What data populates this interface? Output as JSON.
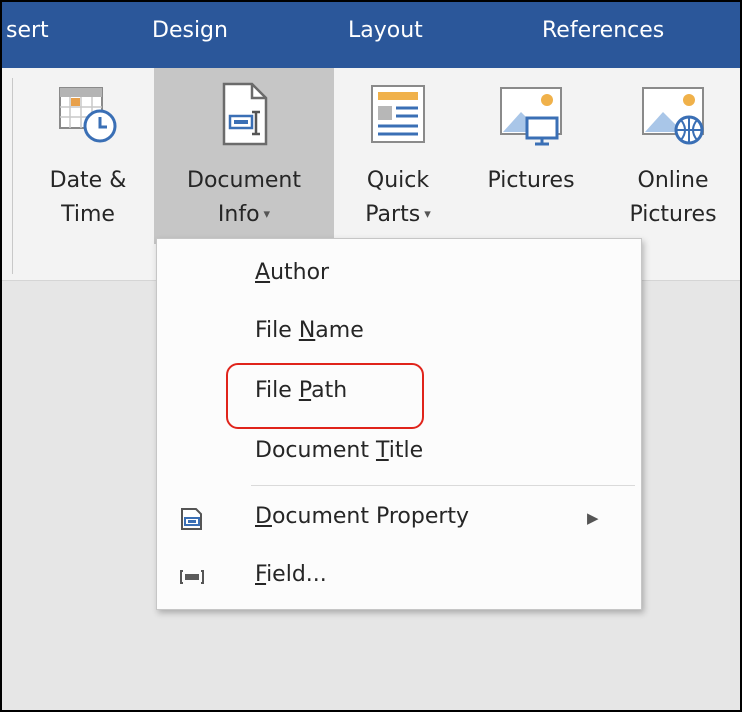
{
  "tabs": [
    {
      "label": "sert"
    },
    {
      "label": "Design"
    },
    {
      "label": "Layout"
    },
    {
      "label": "References"
    }
  ],
  "ribbon": {
    "buttons": [
      {
        "line1": "Date &",
        "line2": "Time",
        "icon": "calendar-clock-icon"
      },
      {
        "line1": "Document",
        "line2": "Info",
        "icon": "document-info-icon",
        "has_dropdown": true,
        "pressed": true
      },
      {
        "line1": "Quick",
        "line2": "Parts",
        "icon": "quick-parts-icon",
        "has_dropdown": true
      },
      {
        "line1": "Pictures",
        "line2": "",
        "icon": "pictures-icon"
      },
      {
        "line1": "Online",
        "line2": "Pictures",
        "icon": "online-pictures-icon"
      }
    ],
    "dropdown_caret": "▾"
  },
  "menu": {
    "items": [
      {
        "pre": "",
        "key": "A",
        "post": "uthor"
      },
      {
        "pre": "File ",
        "key": "N",
        "post": "ame"
      },
      {
        "pre": "File ",
        "key": "P",
        "post": "ath",
        "highlighted": true
      },
      {
        "pre": "Document ",
        "key": "T",
        "post": "itle"
      },
      {
        "pre": "",
        "key": "D",
        "post": "ocument Property",
        "icon": "document-property-icon",
        "submenu_arrow": "▶"
      },
      {
        "pre": "",
        "key": "F",
        "post": "ield...",
        "icon": "field-icon"
      }
    ]
  },
  "colors": {
    "tab_bar": "#2b579a",
    "ribbon": "#f3f3f3",
    "pressed_button": "#c6c6c6",
    "highlight_outline": "#e0241b"
  }
}
